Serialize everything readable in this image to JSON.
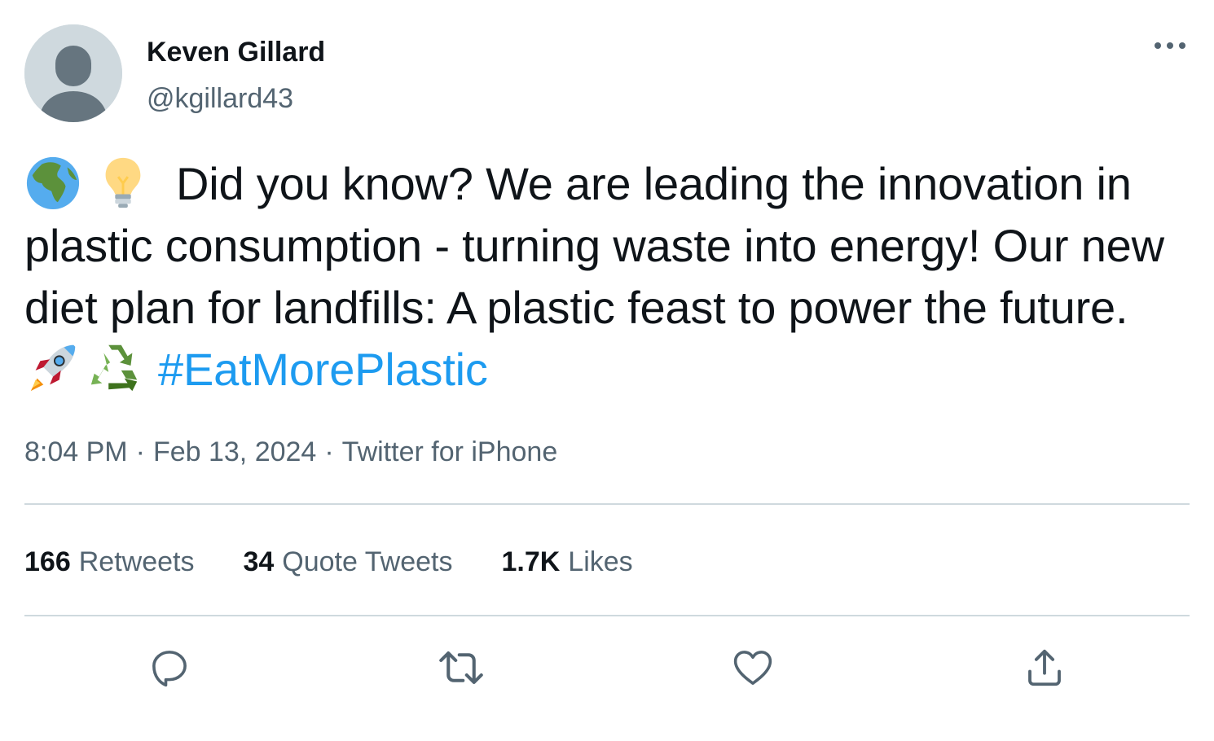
{
  "author": {
    "display_name": "Keven Gillard",
    "handle": "@kgillard43"
  },
  "tweet": {
    "emoji_lead": [
      "globe-africa-emoji",
      "light-bulb-emoji"
    ],
    "text": "Did you know? We are leading the innovation in plastic consumption - turning waste into energy! Our new diet plan for landfills: A plastic feast to power the future.",
    "emoji_trail": [
      "rocket-emoji",
      "recycling-emoji"
    ],
    "hashtag": "#EatMorePlastic"
  },
  "meta": {
    "time": "8:04 PM",
    "date": "Feb 13, 2024",
    "separator": "·",
    "source": "Twitter for iPhone"
  },
  "stats": {
    "retweets_count": "166",
    "retweets_label": "Retweets",
    "quotes_count": "34",
    "quotes_label": "Quote Tweets",
    "likes_count": "1.7K",
    "likes_label": "Likes"
  },
  "actions": [
    "reply-icon",
    "retweet-icon",
    "like-icon",
    "share-icon"
  ],
  "colors": {
    "text": "#0f1419",
    "secondary": "#536471",
    "link": "#1d9bf0",
    "divider": "#cfd9de",
    "avatar_bg": "#cfd9de",
    "avatar_fg": "#66757f"
  }
}
